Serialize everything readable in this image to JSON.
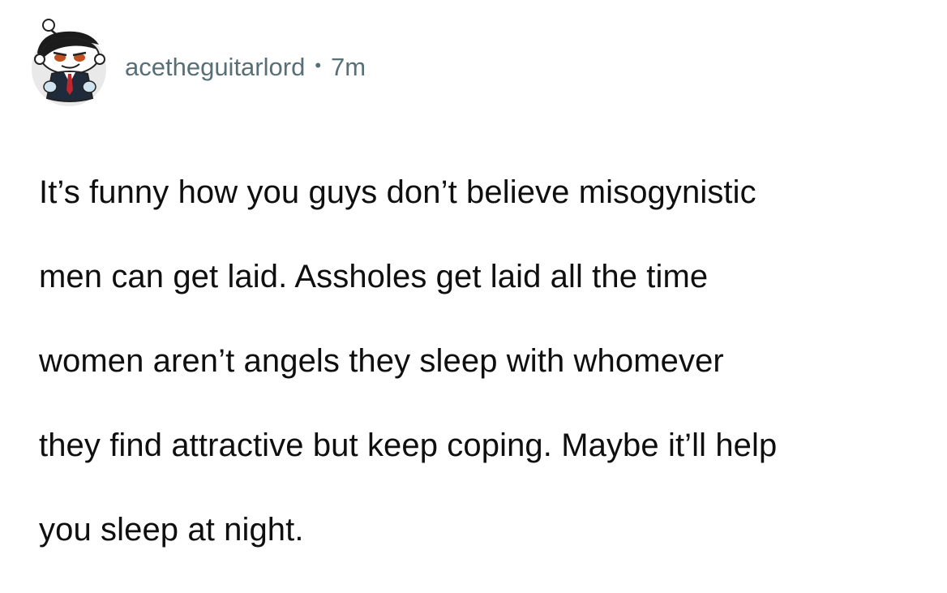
{
  "comment": {
    "author": "acetheguitarlord",
    "separator": "•",
    "timestamp": "7m",
    "avatar_icon": "snoo-avatar-icon",
    "lines": [
      "It’s funny how you guys don’t believe misogynistic",
      "men can get laid. Assholes get laid all the time",
      "women aren’t angels they sleep with whomever",
      "they find attractive but keep coping. Maybe it’ll help",
      "you sleep at night."
    ]
  }
}
